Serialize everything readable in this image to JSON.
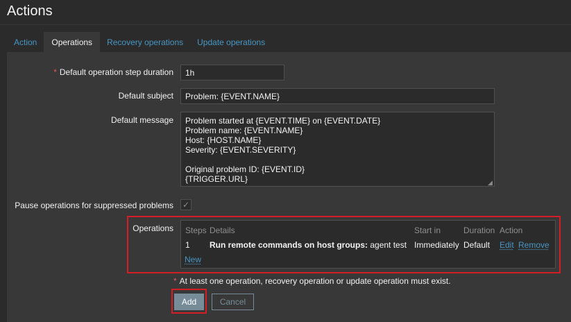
{
  "page": {
    "title": "Actions"
  },
  "tabs": [
    {
      "label": "Action"
    },
    {
      "label": "Operations"
    },
    {
      "label": "Recovery operations"
    },
    {
      "label": "Update operations"
    }
  ],
  "form": {
    "step_duration": {
      "label": "Default operation step duration",
      "required_mark": "*",
      "value": "1h"
    },
    "subject": {
      "label": "Default subject",
      "value": "Problem: {EVENT.NAME}"
    },
    "message": {
      "label": "Default message",
      "value": "Problem started at {EVENT.TIME} on {EVENT.DATE}\nProblem name: {EVENT.NAME}\nHost: {HOST.NAME}\nSeverity: {EVENT.SEVERITY}\n\nOriginal problem ID: {EVENT.ID}\n{TRIGGER.URL}"
    },
    "pause_suppressed": {
      "label": "Pause operations for suppressed problems",
      "checked": true,
      "check_glyph": "✓"
    },
    "operations": {
      "label": "Operations",
      "columns": {
        "steps": "Steps",
        "details": "Details",
        "start_in": "Start in",
        "duration": "Duration",
        "action": "Action"
      },
      "rows": [
        {
          "steps": "1",
          "details_bold": "Run remote commands on host groups:",
          "details_rest": " agent test",
          "start_in": "Immediately",
          "duration": "Default",
          "edit": "Edit",
          "remove": "Remove"
        }
      ],
      "new_link": "New"
    },
    "warning": {
      "mark": "*",
      "text": "At least one operation, recovery operation or update operation must exist."
    },
    "buttons": {
      "add": "Add",
      "cancel": "Cancel"
    }
  },
  "colors": {
    "background": "#2b2b2b",
    "panel": "#383838",
    "link": "#4796c4",
    "required": "#e45959",
    "highlight": "#d41d24",
    "button": "#768d99"
  }
}
